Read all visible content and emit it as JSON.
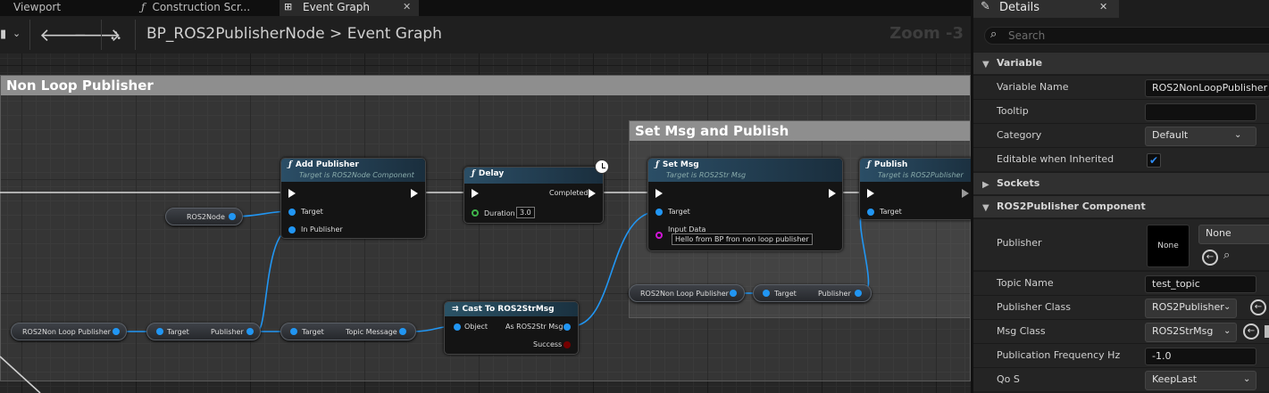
{
  "tabs": [
    {
      "label": "Viewport"
    },
    {
      "label": "Construction Scr..."
    },
    {
      "label": "Event Graph"
    }
  ],
  "breadcrumb": {
    "blueprint": "BP_ROS2PublisherNode",
    "separator": ">",
    "graph": "Event Graph"
  },
  "zoom": "Zoom -3",
  "graph": {
    "comment_outer": "Non Loop Publisher",
    "comment_inner": "Set Msg and Publish",
    "nodes": {
      "add_publisher": {
        "title": "Add Publisher",
        "subtitle": "Target is ROS2Node Component",
        "pin_target": "Target",
        "pin_in_publisher": "In Publisher"
      },
      "delay": {
        "title": "Delay",
        "pin_completed": "Completed",
        "pin_duration": "Duration",
        "duration_value": "3.0"
      },
      "set_msg": {
        "title": "Set Msg",
        "subtitle": "Target is ROS2Str Msg",
        "pin_target": "Target",
        "pin_input_data": "Input Data",
        "input_value": "Hello from BP fron non loop publisher"
      },
      "publish": {
        "title": "Publish",
        "subtitle": "Target is ROS2Publisher",
        "pin_target": "Target"
      },
      "cast": {
        "title": "Cast To ROS2StrMsg",
        "pin_object": "Object",
        "pin_as": "As ROS2Str Msg",
        "pin_success": "Success"
      },
      "get_publisher_1": {
        "pin_target": "Target",
        "pin_publisher": "Publisher"
      },
      "get_topic_message": {
        "pin_target": "Target",
        "pin_topic": "Topic Message"
      },
      "get_publisher_2": {
        "pin_target": "Target",
        "pin_publisher": "Publisher"
      }
    },
    "vars": {
      "ros2node": "ROS2Node",
      "non_loop_publisher_left": "ROS2Non Loop Publisher",
      "non_loop_publisher_right": "ROS2Non Loop Publisher"
    }
  },
  "details": {
    "title": "Details",
    "search_placeholder": "Search",
    "categories": {
      "variable": "Variable",
      "sockets": "Sockets",
      "component": "ROS2Publisher Component"
    },
    "rows": {
      "variable_name": {
        "label": "Variable Name",
        "value": "ROS2NonLoopPublisher"
      },
      "tooltip": {
        "label": "Tooltip",
        "value": ""
      },
      "category": {
        "label": "Category",
        "value": "Default"
      },
      "editable": {
        "label": "Editable when Inherited",
        "checked": true
      },
      "publisher": {
        "label": "Publisher",
        "thumb": "None",
        "value": "None"
      },
      "topic_name": {
        "label": "Topic Name",
        "value": "test_topic"
      },
      "publisher_class": {
        "label": "Publisher Class",
        "value": "ROS2Publisher"
      },
      "msg_class": {
        "label": "Msg Class",
        "value": "ROS2StrMsg"
      },
      "frequency": {
        "label": "Publication Frequency Hz",
        "value": "-1.0"
      },
      "qos": {
        "label": "Qo S",
        "value": "KeepLast"
      }
    }
  },
  "colors": {
    "accent": "#2196f3",
    "exec": "#ffffff",
    "float_pin": "#3fb44b",
    "struct_pin": "#d014d6",
    "node_header": "#2b4e66"
  }
}
